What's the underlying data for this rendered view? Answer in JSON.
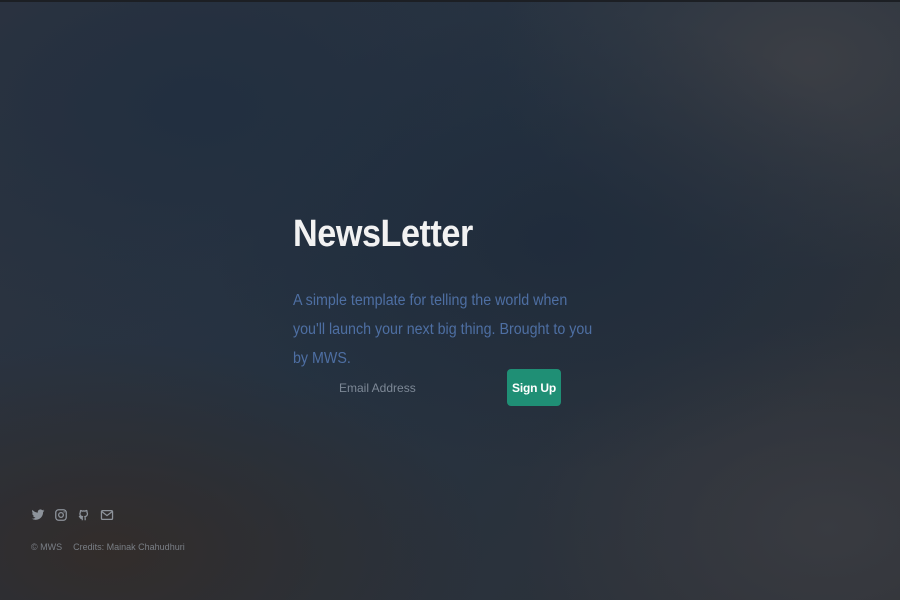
{
  "header": {
    "title": "NewsLetter",
    "subtitle": "A simple template for telling the world when you'll launch your next big thing. Brought to you by MWS."
  },
  "signup": {
    "email_placeholder": "Email Address",
    "button_label": "Sign Up"
  },
  "footer": {
    "social_icons": [
      "twitter-icon",
      "instagram-icon",
      "github-icon",
      "email-icon"
    ],
    "copyright": "© MWS",
    "credits": "Credits: Mainak Chahudhuri"
  },
  "colors": {
    "accent": "#1f8f75",
    "title": "#f2f2f2",
    "subtitle": "#4e6fa3",
    "footer_text": "#7a7f86"
  }
}
